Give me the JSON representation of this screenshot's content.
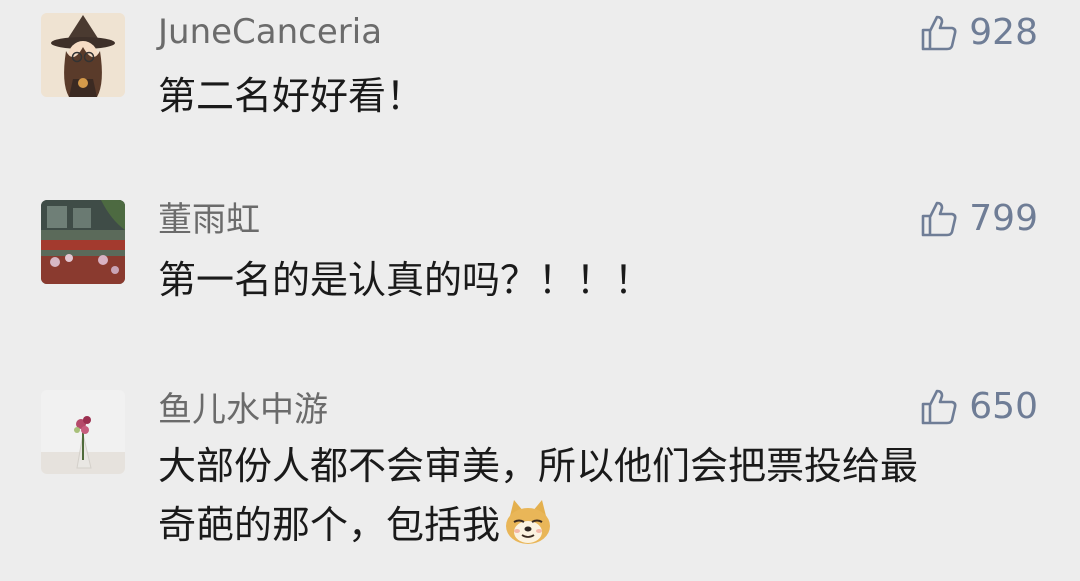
{
  "comments": [
    {
      "username": "JuneCanceria",
      "text": "第二名好好看！",
      "likes": "928",
      "avatar_icon": "witch-girl-avatar"
    },
    {
      "username": "董雨虹",
      "text": "第一名的是认真的吗？！！！",
      "likes": "799",
      "avatar_icon": "building-flowers-avatar"
    },
    {
      "username": "鱼儿水中游",
      "text_line1": "大部份人都不会审美，所以他们会把票投给最",
      "text_line2": "奇葩的那个，包括我",
      "likes": "650",
      "avatar_icon": "flower-bouquet-avatar",
      "emoji": "doge-emoji"
    }
  ],
  "colors": {
    "background": "#ededed",
    "username": "#6b6b6b",
    "like": "#6f7d96",
    "text": "#1a1a1a"
  }
}
